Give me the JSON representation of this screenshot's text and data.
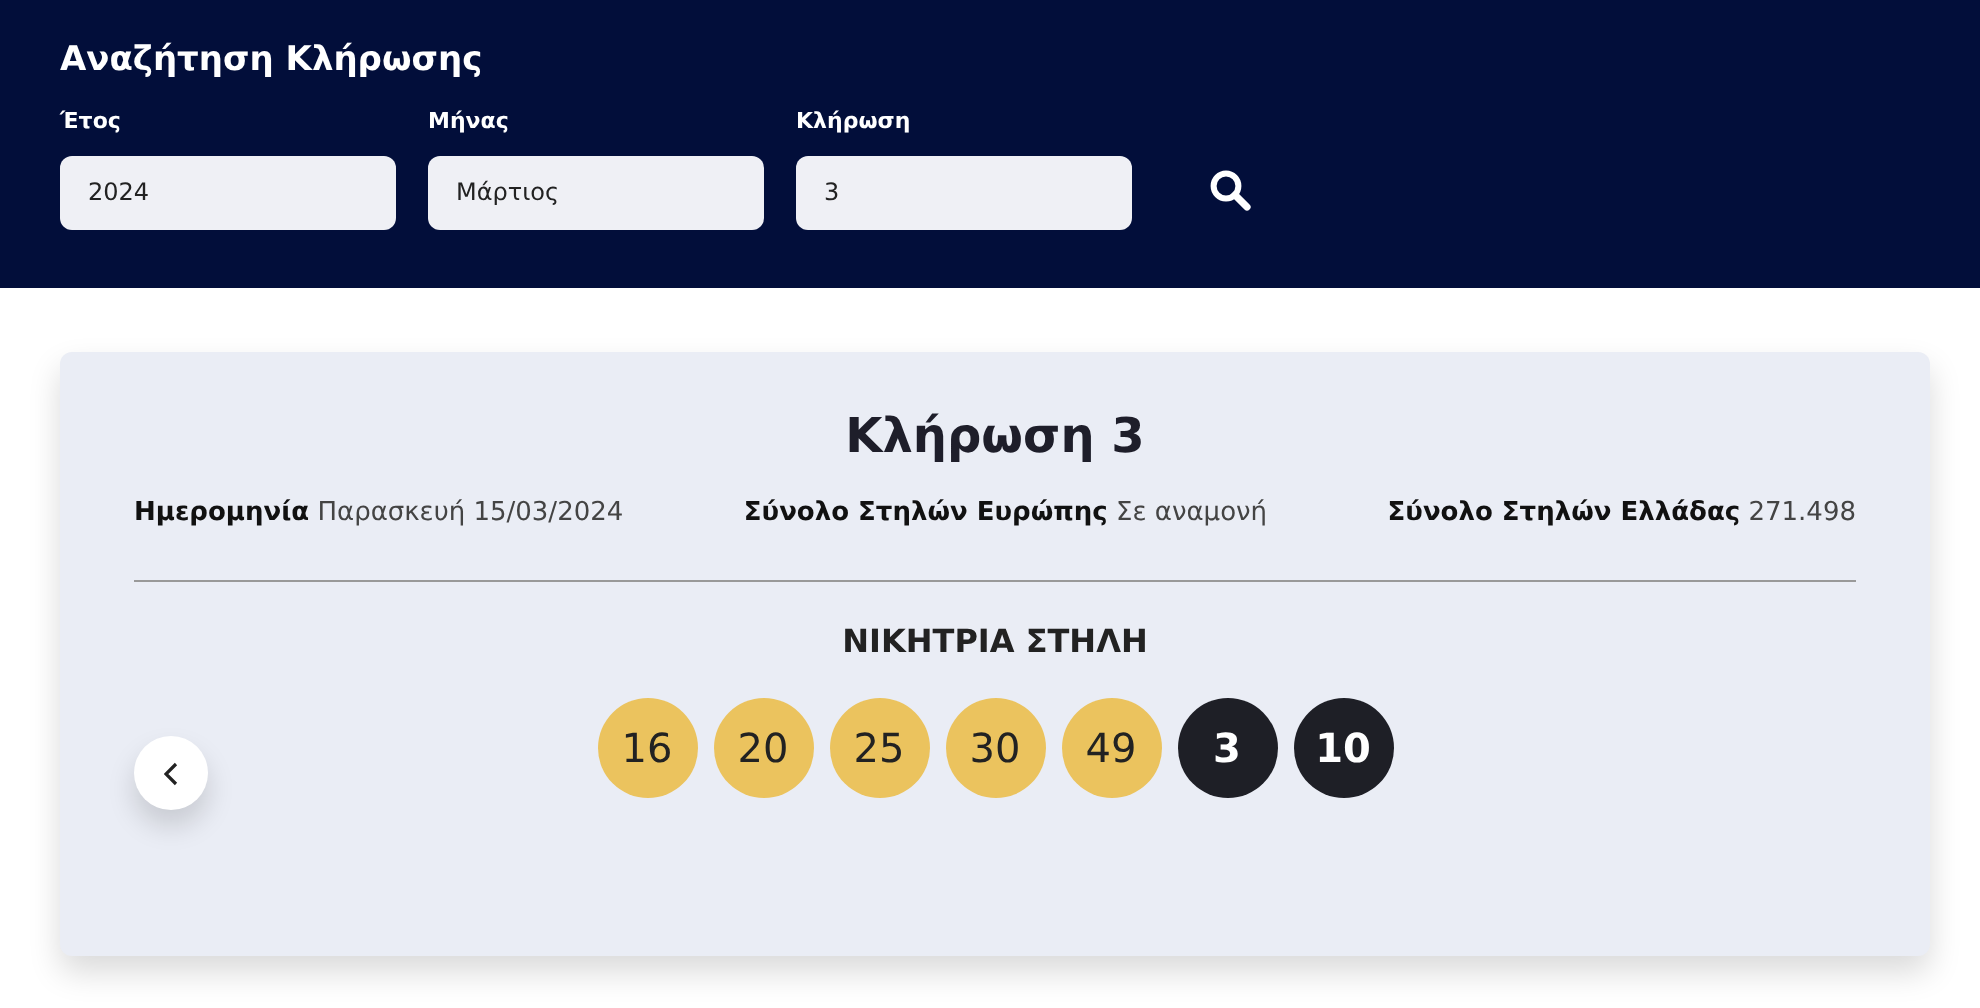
{
  "search": {
    "title": "Αναζήτηση Κλήρωσης",
    "fields": [
      {
        "label": "Έτος",
        "value": "2024"
      },
      {
        "label": "Μήνας",
        "value": "Μάρτιος"
      },
      {
        "label": "Κλήρωση",
        "value": "3"
      }
    ]
  },
  "draw": {
    "title": "Κλήρωση 3",
    "info": [
      {
        "label": "Ημερομηνία",
        "value": "Παρασκευή 15/03/2024"
      },
      {
        "label": "Σύνολο Στηλών Ευρώπης",
        "value": "Σε αναμονή"
      },
      {
        "label": "Σύνολο Στηλών Ελλάδας",
        "value": "271.498"
      }
    ],
    "winning_heading": "ΝΙΚΗΤΡΙΑ ΣΤΗΛΗ",
    "balls": [
      {
        "number": "16",
        "kind": "main"
      },
      {
        "number": "20",
        "kind": "main"
      },
      {
        "number": "25",
        "kind": "main"
      },
      {
        "number": "30",
        "kind": "main"
      },
      {
        "number": "49",
        "kind": "main"
      },
      {
        "number": "3",
        "kind": "bonus"
      },
      {
        "number": "10",
        "kind": "bonus"
      }
    ]
  }
}
